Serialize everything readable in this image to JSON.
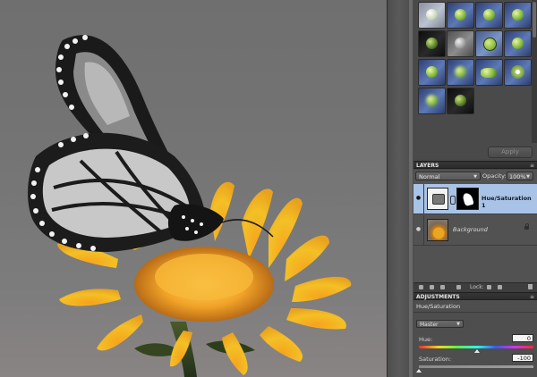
{
  "effects_panel": {
    "thumbnails": [
      "effect-thumb",
      "effect-thumb",
      "effect-thumb",
      "effect-thumb",
      "effect-thumb",
      "effect-thumb",
      "effect-thumb",
      "effect-thumb",
      "effect-thumb",
      "effect-thumb",
      "effect-thumb",
      "effect-thumb",
      "effect-thumb",
      "effect-thumb"
    ],
    "apply_label": "Apply"
  },
  "layers_panel": {
    "header": "LAYERS",
    "blend_mode": "Normal",
    "opacity_label": "Opacity:",
    "opacity_value": "100%",
    "layers": [
      {
        "name": "Hue/Saturation 1",
        "selected": true
      },
      {
        "name": "Background",
        "selected": false
      }
    ],
    "lock_label": "Lock:"
  },
  "adjustments_panel": {
    "header": "ADJUSTMENTS",
    "title": "Hue/Saturation",
    "channel": "Master",
    "hue_label": "Hue:",
    "hue_value": "0",
    "saturation_label": "Saturation:",
    "saturation_value": "-100"
  },
  "colors": {
    "selection": "#a9c3e6",
    "panel": "#474747",
    "header": "#2c2c2c"
  }
}
